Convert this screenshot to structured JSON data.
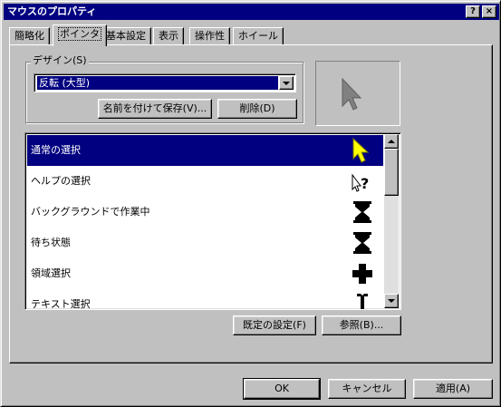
{
  "window": {
    "title": "マウスのプロパティ",
    "help_button": "?",
    "close_button": "×"
  },
  "tabs": [
    {
      "label": "簡略化",
      "active": false
    },
    {
      "label": "ポインタ",
      "active": true
    },
    {
      "label": "基本設定",
      "active": false
    },
    {
      "label": "表示",
      "active": false
    },
    {
      "label": "操作性",
      "active": false
    },
    {
      "label": "ホイール",
      "active": false
    }
  ],
  "scheme": {
    "legend": "デザイン(S)",
    "selected": "反転 (大型)",
    "save_as_label": "名前を付けて保存(V)...",
    "delete_label": "削除(D)"
  },
  "preview": {
    "icon": "arrow-cursor-icon"
  },
  "cursor_list": {
    "items": [
      {
        "label": "通常の選択",
        "icon": "normal-select-cursor-icon",
        "selected": true
      },
      {
        "label": "ヘルプの選択",
        "icon": "help-select-cursor-icon",
        "selected": false
      },
      {
        "label": "バックグラウンドで作業中",
        "icon": "working-in-background-cursor-icon",
        "selected": false
      },
      {
        "label": "待ち状態",
        "icon": "busy-hourglass-cursor-icon",
        "selected": false
      },
      {
        "label": "領域選択",
        "icon": "precision-select-cursor-icon",
        "selected": false
      },
      {
        "label": "テキスト選択",
        "icon": "text-select-cursor-icon",
        "selected": false
      }
    ],
    "default_label": "既定の設定(F)",
    "browse_label": "参照(B)..."
  },
  "footer": {
    "ok_label": "OK",
    "cancel_label": "キャンセル",
    "apply_label": "適用(A)"
  },
  "colors": {
    "selection": "#000080",
    "cursor_highlight": "#ffff00",
    "face": "#c0c0c0"
  }
}
